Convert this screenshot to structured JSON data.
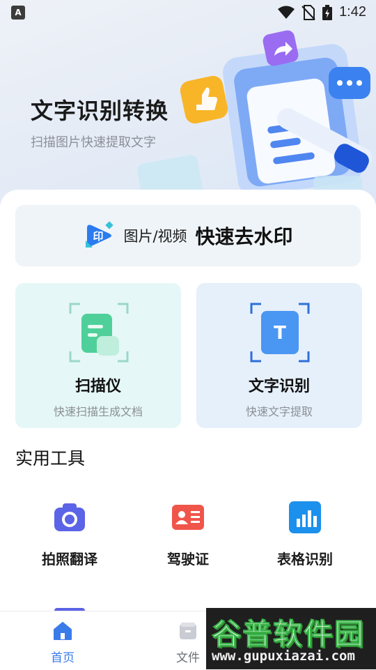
{
  "status_bar": {
    "app_badge": "A",
    "time": "1:42",
    "icons": [
      "wifi-icon",
      "no-sim-icon",
      "battery-charging-icon"
    ]
  },
  "hero": {
    "title": "文字识别转换",
    "subtitle": "扫描图片快速提取文字"
  },
  "watermark_removal": {
    "badge_text": "印",
    "small_label": "图片/视频",
    "big_label": "快速去水印"
  },
  "features": [
    {
      "title": "扫描仪",
      "desc": "快速扫描生成文档",
      "icon": "document-scan-icon"
    },
    {
      "title": "文字识别",
      "desc": "快速文字提取",
      "icon": "text-recognition-icon",
      "icon_letter": "T"
    }
  ],
  "tools_section": {
    "title": "实用工具",
    "items": [
      {
        "label": "拍照翻译",
        "icon": "camera-icon"
      },
      {
        "label": "驾驶证",
        "icon": "id-card-icon"
      },
      {
        "label": "表格识别",
        "icon": "table-chart-icon"
      }
    ]
  },
  "bottom_nav": {
    "items": [
      {
        "label": "首页",
        "icon": "home-icon",
        "active": true
      },
      {
        "label": "文件",
        "icon": "folder-icon",
        "active": false
      }
    ]
  },
  "overlay_watermark": {
    "name": "谷普软件园",
    "url": "www.gupuxiazai.com"
  },
  "colors": {
    "accent": "#3a7bea",
    "scan_bg": "#e5f7f6",
    "ocr_bg": "#e6f0fb",
    "card_bg": "#eff4f8"
  }
}
